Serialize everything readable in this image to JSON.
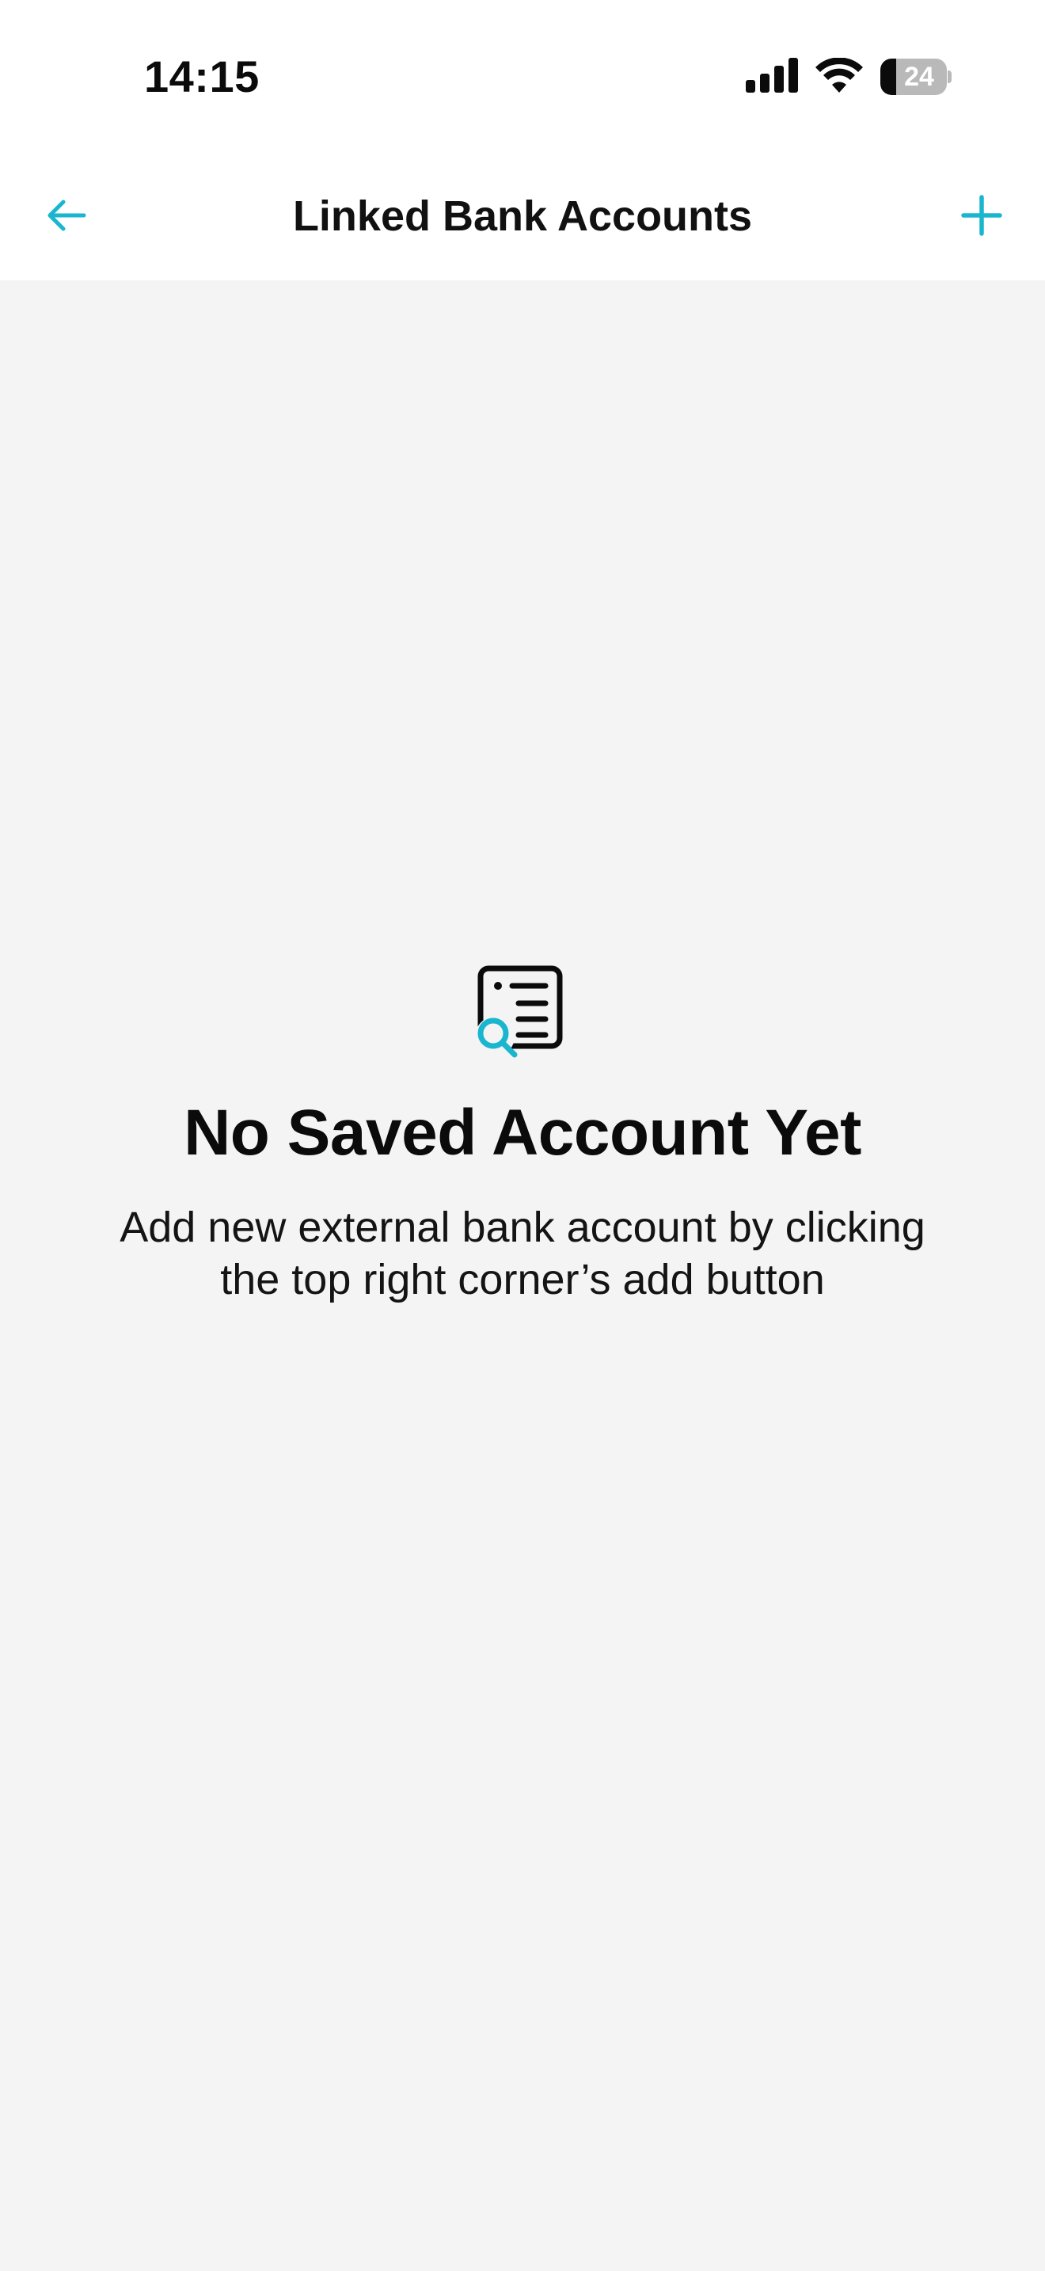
{
  "status_bar": {
    "time": "14:15",
    "battery_percent": "24",
    "battery_level": 0.24,
    "icons": [
      "signal-icon",
      "wifi-icon",
      "battery-icon"
    ]
  },
  "nav": {
    "title": "Linked Bank Accounts",
    "back_icon": "arrow-left-icon",
    "add_icon": "plus-icon"
  },
  "empty_state": {
    "icon": "document-search-icon",
    "title": "No Saved Account Yet",
    "description": "Add new external bank account by clicking the top right corner’s add button"
  },
  "colors": {
    "accent": "#1ab6cf",
    "background": "#f4f4f4",
    "surface": "#ffffff",
    "text": "#0b0b0b"
  }
}
